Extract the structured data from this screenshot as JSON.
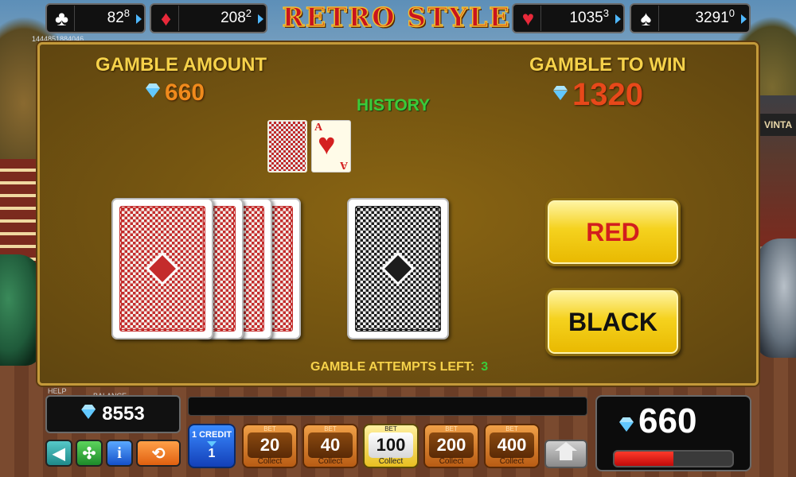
{
  "topbar": {
    "jackpots": [
      {
        "suit_icon": "club-icon",
        "glyph": "♣",
        "value": "82",
        "sup": "8"
      },
      {
        "suit_icon": "diamond-icon",
        "glyph": "♦",
        "value": "208",
        "sup": "2"
      },
      {
        "suit_icon": "heart-icon",
        "glyph": "♥",
        "value": "1035",
        "sup": "3"
      },
      {
        "suit_icon": "spade-icon",
        "glyph": "♠",
        "value": "3291",
        "sup": "0"
      }
    ],
    "logo": "RETRO STYLE",
    "serial": "1444851884046"
  },
  "gamble": {
    "amount_label": "GAMBLE AMOUNT",
    "amount_value": "660",
    "win_label": "GAMBLE TO WIN",
    "win_value": "1320",
    "history_label": "HISTORY",
    "history_ace_rank": "A",
    "history_ace_suit": "♥",
    "red_button": "RED",
    "black_button": "BLACK",
    "attempts_label": "GAMBLE ATTEMPTS LEFT:",
    "attempts_value": "3"
  },
  "background": {
    "sign_text": "VINTA"
  },
  "bottom": {
    "help_label": "HELP",
    "balance_label": "BALANCE",
    "balance_value": "8553",
    "credit_label": "1 CREDIT",
    "credit_value": "1",
    "bet_top_label": "BET",
    "bet_bottom_label": "Collect",
    "bets": [
      "20",
      "40",
      "100",
      "200",
      "400"
    ],
    "win_value": "660",
    "win_progress": 0.5,
    "icons": {
      "sound": "speaker-icon",
      "fullscreen": "collapse-arrows-icon",
      "info": "info-icon",
      "autoplay": "autoplay-icon",
      "home": "home-icon"
    }
  },
  "colors": {
    "panel": "#6f5010",
    "header_yellow": "#f6d24a",
    "amount_orange": "#f08a1c",
    "win_red": "#e8481a",
    "history_green": "#3acb3a",
    "button_yellow": "#f5d21e"
  }
}
